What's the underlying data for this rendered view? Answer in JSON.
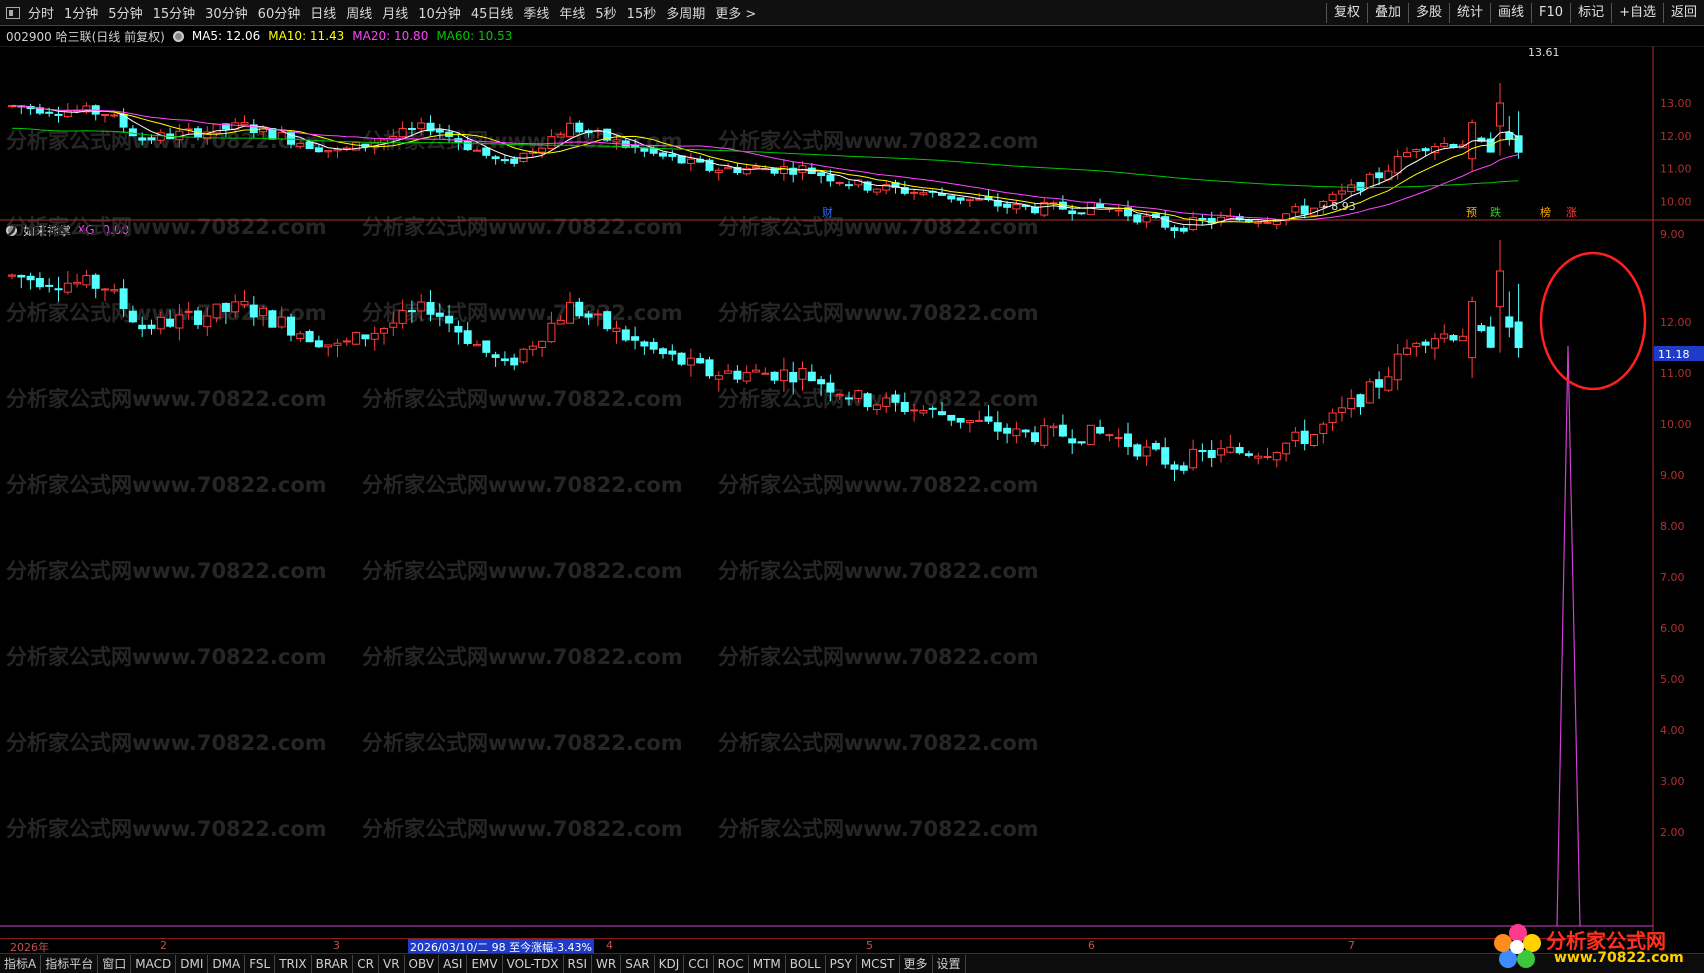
{
  "toolbar": {
    "periods": [
      "分时",
      "1分钟",
      "5分钟",
      "15分钟",
      "30分钟",
      "60分钟",
      "日线",
      "周线",
      "月线",
      "10分钟",
      "45日线",
      "季线",
      "年线",
      "5秒",
      "15秒",
      "多周期",
      "更多 >"
    ],
    "right_buttons": [
      "复权",
      "叠加",
      "多股",
      "统计",
      "画线",
      "F10",
      "标记",
      "+自选",
      "返回"
    ]
  },
  "info": {
    "stock": "002900 哈三联(日线 前复权)",
    "ma5": "MA5: 12.06",
    "ma10": "MA10: 11.43",
    "ma20": "MA20: 10.80",
    "ma60": "MA60: 10.53"
  },
  "indicator": {
    "name": "如来神掌",
    "xg": "XG: 0.00"
  },
  "colors": {
    "up": "#ff3c3c",
    "down": "#54ffff",
    "ma5": "#ffffff",
    "ma10": "#ffff00",
    "ma20": "#ff44ff",
    "ma60": "#00c800",
    "axis": "#b03030",
    "signal": "#d040d0",
    "ellipse": "#ff2020"
  },
  "chart_data": {
    "type": "candlestick",
    "main_yaxis_ticks": [
      "13.00",
      "12.00",
      "11.00",
      "10.00",
      "9.00"
    ],
    "sub_yaxis_ticks": [
      "12.00",
      "11.00",
      "10.00",
      "9.00",
      "8.00",
      "7.00",
      "6.00",
      "5.00",
      "4.00",
      "3.00",
      "2.00"
    ],
    "price_tag": "11.18",
    "high_label": "13.61",
    "low_label": "8.93",
    "event_markers": [
      "财",
      "预",
      "跌",
      "榜",
      "涨"
    ],
    "series": [
      {
        "name": "MA5",
        "values": []
      },
      {
        "name": "MA10",
        "values": []
      },
      {
        "name": "MA20",
        "values": []
      },
      {
        "name": "MA60",
        "values": []
      }
    ]
  },
  "bottom_axis": {
    "labels": [
      "2026年",
      "2",
      "3",
      "4",
      "5",
      "6",
      "7"
    ],
    "highlight": "2026/03/10/二 98 至今涨幅-3.43%"
  },
  "tabs": [
    "指标A",
    "指标平台",
    "窗口",
    "MACD",
    "DMI",
    "DMA",
    "FSL",
    "TRIX",
    "BRAR",
    "CR",
    "VR",
    "OBV",
    "ASI",
    "EMV",
    "VOL-TDX",
    "RSI",
    "WR",
    "SAR",
    "KDJ",
    "CCI",
    "ROC",
    "MTM",
    "BOLL",
    "PSY",
    "MCST",
    "更多",
    "设置"
  ],
  "brand": {
    "name": "分析家公式网",
    "url": "www.70822.com"
  },
  "watermark": "分析家公式网www.70822.com"
}
